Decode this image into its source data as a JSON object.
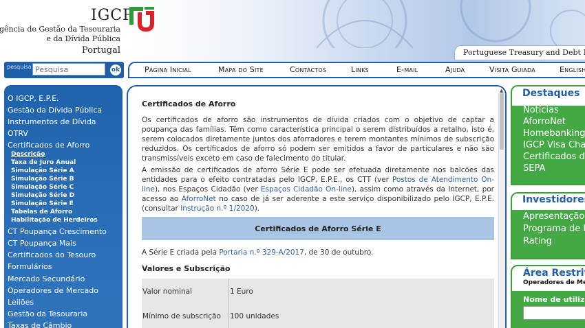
{
  "header": {
    "logo": "IGCP",
    "agency_line1": "Agência de Gestão da Tesouraria",
    "agency_line2": "e da Dívida Pública",
    "agency_line3": "Portugal",
    "tagline": "Portuguese Treasury and Debt Man"
  },
  "search": {
    "label": "pesquisa",
    "placeholder": "Pesquisa",
    "button": "ok"
  },
  "topnav": [
    "Página Inicial",
    "Mapa do Site",
    "Contactos",
    "Links",
    "E-mail",
    "Ajuda",
    "Visita Guiada",
    "English"
  ],
  "sidebar": {
    "items": [
      "O IGCP, E.P.E.",
      "Gestão da Dívida Pública",
      "Instrumentos de Dívida",
      "OTRV",
      "Certificados de Aforro"
    ],
    "subitems": [
      "Descrição",
      "Taxa de Juro Anual",
      "Simulação Série A",
      "Simulação Série B",
      "Simulação Série C",
      "Simulação Série D",
      "Simulação Série E",
      "Tabelas de Aforro",
      "Habilitação de Herdeiros"
    ],
    "items_after": [
      "CT Poupança Crescimento",
      "CT Poupança Mais",
      "Certificados do Tesouro",
      "Formulários",
      "Mercado Secundário",
      "Operadores de Mercado",
      "Leilões",
      "Gestão da Tesouraria",
      "Taxas de Câmbio"
    ]
  },
  "content": {
    "title": "Certificados de Aforro",
    "p1": "Os certificados de aforro são instrumentos de dívida criados com o objetivo de captar a poupança das famílias. Têm como característica principal o serem distribuídos a retalho, isto é, serem colocados diretamente juntos dos aforradores e terem montantes mínimos de subscrição reduzidos. Os certificados de aforro só podem ser emitidos a favor de particulares e não são transmissíveis exceto em caso de falecimento do titular.",
    "p2_a": "A emissão de certificados de aforro Série E pode ser efetuada diretamente nos balcões das entidades para o efeito contratadas pelo IGCP, E.P.E., os CTT (ver ",
    "p2_link1": "Postos de Atendimento On-line",
    "p2_b": "), nos Espaços Cidadão (ver ",
    "p2_link2": "Espaços Cidadão On-line",
    "p2_c": "), assim como  através da Internet, por acesso ao ",
    "p2_link3": "AforroNet",
    "p2_d": "  no caso de já ser aderente a este serviço disponibilizado pelo IGCP, E.P.E. (consultar ",
    "p2_link4": "Instrução n.º 1/2020",
    "p2_e": ").",
    "banner": "Certificados de Aforro Série E",
    "p3_a": "A Série E criada pela ",
    "p3_link": "Portaria n.º 329-A/2017",
    "p3_b": ", de 30 de outubro.",
    "section": "Valores e Subscrição",
    "table": [
      {
        "label": "Valor nominal",
        "value": "1 Euro"
      },
      {
        "label": "Mínimo de subscrição",
        "value": "100 unidades"
      }
    ]
  },
  "right": {
    "destaques_title": "Destaques",
    "destaques": [
      "Notícias",
      "AforroNet",
      "Homebanking",
      "IGCP Visa Char",
      "Certificados de",
      "SEPA"
    ],
    "investidores_title": "Investidores",
    "investidores": [
      "Apresentação a",
      "Programa de F",
      "Rating"
    ],
    "restrita_title": "Área Restrita",
    "restrita_sub": "Operadores de Merca",
    "username_label": "Nome de utilizad"
  },
  "colors": {
    "brand_blue": "#1f5fa8",
    "green": "#44a844",
    "banner": "#aac4e4",
    "logo_green": "#2d9c3c",
    "logo_red": "#d8232a"
  }
}
